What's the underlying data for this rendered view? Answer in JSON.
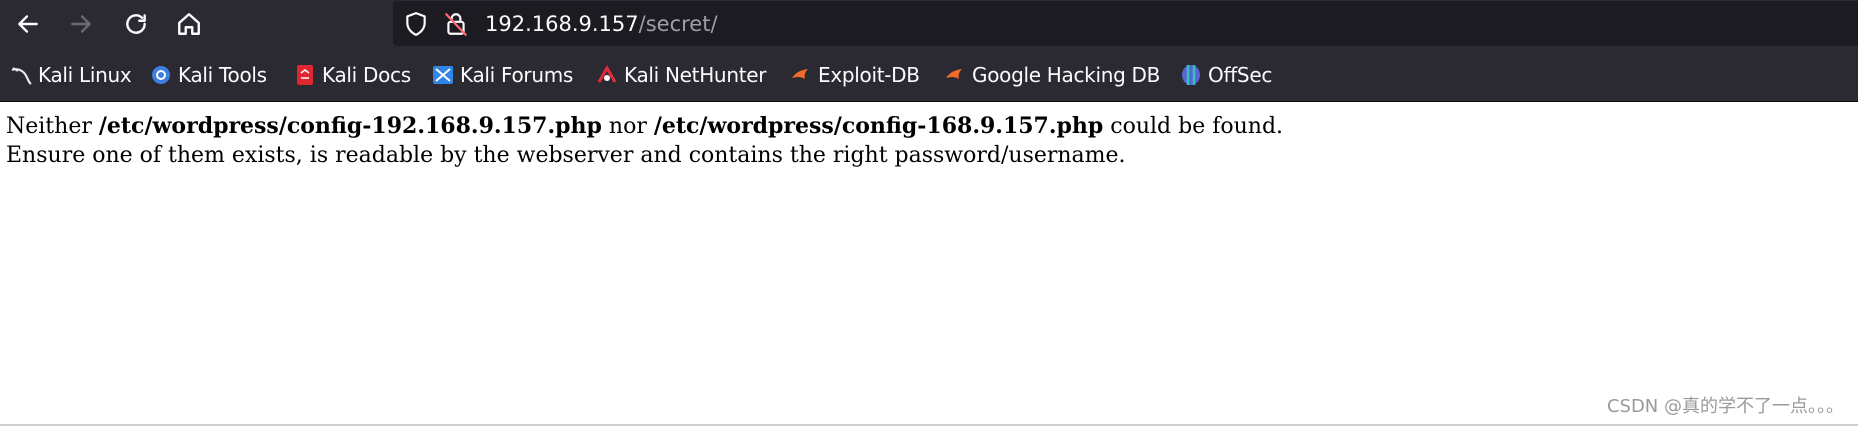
{
  "colors": {
    "toolbar_bg": "#2b2a33",
    "urlbar_bg": "#1c1b22",
    "text_light": "#fbfbfe",
    "text_dim": "#9e9ea6"
  },
  "toolbar": {
    "back_icon": "arrow-left-icon",
    "forward_icon": "arrow-right-icon",
    "reload_icon": "reload-icon",
    "home_icon": "home-icon"
  },
  "urlbar": {
    "host": "192.168.9.157",
    "path": "/secret/",
    "icons": [
      "shield-icon",
      "insecure-lock-icon"
    ]
  },
  "bookmarks": [
    {
      "label": "Kali Linux",
      "icon": "kali-dragon-icon"
    },
    {
      "label": "Kali Tools",
      "icon": "kali-tools-icon"
    },
    {
      "label": "Kali Docs",
      "icon": "kali-docs-icon"
    },
    {
      "label": "Kali Forums",
      "icon": "kali-forums-icon"
    },
    {
      "label": "Kali NetHunter",
      "icon": "nethunter-icon"
    },
    {
      "label": "Exploit-DB",
      "icon": "exploit-db-icon"
    },
    {
      "label": "Google Hacking DB",
      "icon": "ghdb-icon"
    },
    {
      "label": "OffSec",
      "icon": "offsec-icon"
    }
  ],
  "page": {
    "line1_pre": "Neither ",
    "line1_path1": "/etc/wordpress/config-192.168.9.157.php",
    "line1_mid": " nor ",
    "line1_path2": "/etc/wordpress/config-168.9.157.php",
    "line1_post": " could be found.",
    "line2": "Ensure one of them exists, is readable by the webserver and contains the right password/username."
  },
  "watermark": "CSDN @真的学不了一点。。。"
}
